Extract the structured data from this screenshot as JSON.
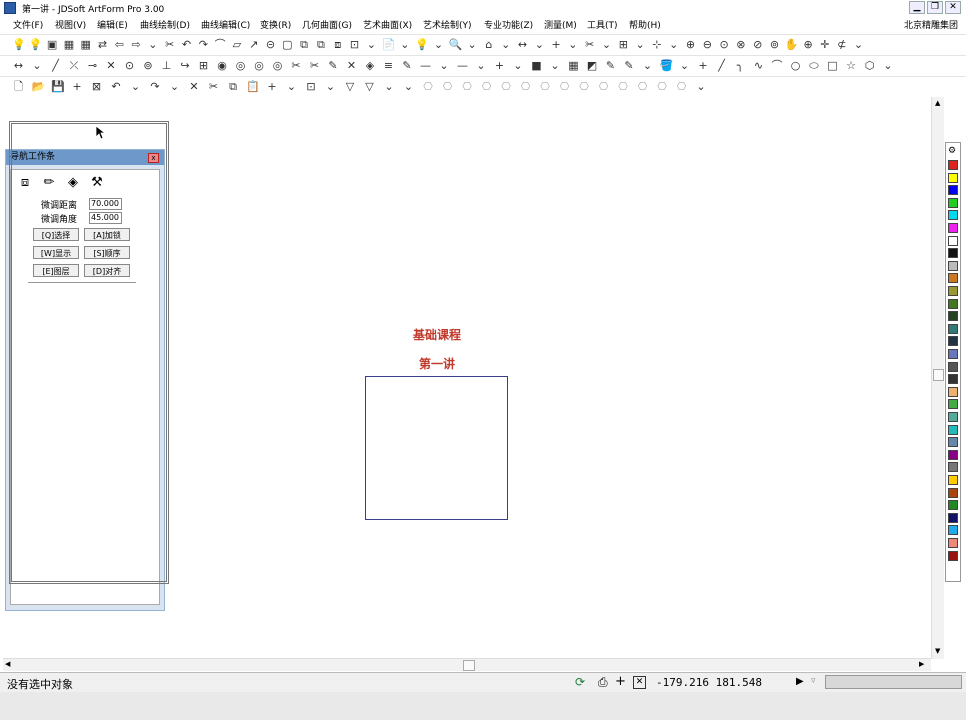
{
  "window": {
    "title": "第一讲 - JDSoft ArtForm Pro 3.00",
    "buttons": {
      "minimize": "▁",
      "restore": "❐",
      "close": "✕"
    },
    "company": "北京精雕集团"
  },
  "menu": [
    "文件(F)",
    "视图(V)",
    "编辑(E)",
    "曲线绘制(D)",
    "曲线编辑(C)",
    "变换(R)",
    "几何曲面(G)",
    "艺术曲面(X)",
    "艺术绘制(Y)",
    "专业功能(Z)",
    "测量(M)",
    "工具(T)",
    "帮助(H)"
  ],
  "toolbar_glyphs": {
    "row1": [
      "💡",
      "💡",
      "▣",
      "▦",
      "▦",
      "⇄",
      "⇦",
      "⇨",
      "⌄",
      "✂",
      "↶",
      "↷",
      "⌒",
      "▱",
      "↗",
      "⊝",
      "▢",
      "⧉",
      "⧉",
      "⧈",
      "⊡",
      "⌄",
      "📄",
      "⌄",
      "💡",
      "⌄",
      "🔍",
      "⌄",
      "⌂",
      "⌄",
      "↔",
      "⌄",
      "+",
      "⌄",
      "✂",
      "⌄",
      "⊞",
      "⌄",
      "⊹",
      "⌄",
      "⊕",
      "⊖",
      "⊙",
      "⊗",
      "⊘",
      "⊚",
      "✋",
      "⊕",
      "✛",
      "⊄",
      "⌄"
    ],
    "row2": [
      "↔",
      "⌄",
      "╱",
      "⤫",
      "⊸",
      "✕",
      "⊙",
      "⊚",
      "⊥",
      "↪",
      "⊞",
      "◉",
      "◎",
      "◎",
      "◎",
      "✂",
      "✂",
      "✎",
      "✕",
      "◈",
      "≡",
      "✎",
      "—",
      "⌄",
      "—",
      "⌄",
      "+",
      "⌄",
      "■",
      "⌄",
      "▦",
      "◩",
      "✎",
      "✎",
      "⌄",
      "🪣",
      "⌄",
      "+",
      "╱",
      "╮",
      "∿",
      "⌒",
      "○",
      "⬭",
      "□",
      "☆",
      "⬡",
      "⌄"
    ],
    "row3": [
      "🗋",
      "📂",
      "💾",
      "+",
      "⊠",
      "↶",
      "⌄",
      "↷",
      "⌄",
      "✕",
      "✂",
      "⧉",
      "📋",
      "+",
      "⌄",
      "⊡",
      "⌄",
      "▽",
      "▽",
      "⌄",
      "⌄",
      "⎔",
      "⎔",
      "⎔",
      "⎔",
      "⎔",
      "⎔",
      "⎔",
      "⎔",
      "⎔",
      "⎔",
      "⎔",
      "⎔",
      "⎔",
      "⎔",
      "⌄"
    ]
  },
  "nav_panel": {
    "title": "导航工作条",
    "tab_icons": [
      "cube-icon",
      "pencil-icon",
      "eraser-icon",
      "tools-icon"
    ],
    "tab_glyphs": [
      "⧈",
      "✏",
      "◈",
      "⚒"
    ],
    "fields": [
      {
        "label": "微调距离",
        "value": "70.000"
      },
      {
        "label": "微调角度",
        "value": "45.000"
      }
    ],
    "buttons": [
      [
        "[Q]选择",
        "[A]加锁"
      ],
      [
        "[W]显示",
        "[S]顺序"
      ],
      [
        "[E]图层",
        "[D]对齐"
      ]
    ]
  },
  "drawing": {
    "title_line1": "基础课程",
    "title_line2": "第一讲"
  },
  "palette": {
    "colors": [
      "#dd2222",
      "#ffff00",
      "#0000ee",
      "#22cc22",
      "#00d8f0",
      "#ee22ee",
      "#ffffff",
      "#111111",
      "#bbbbbb",
      "#cc7722",
      "#999933",
      "#447722",
      "#224422",
      "#337777",
      "#223344",
      "#6677bb",
      "#555555",
      "#333333",
      "#f0b070",
      "#44aa44",
      "#55aa99",
      "#22bbbb",
      "#6688aa",
      "#880088",
      "#777777",
      "#ffcc00",
      "#aa4411",
      "#228822",
      "#111166",
      "#22aaee",
      "#ee8877",
      "#991111"
    ]
  },
  "status": {
    "text": "没有选中对象",
    "coordinates": "-179.216  181.548"
  }
}
